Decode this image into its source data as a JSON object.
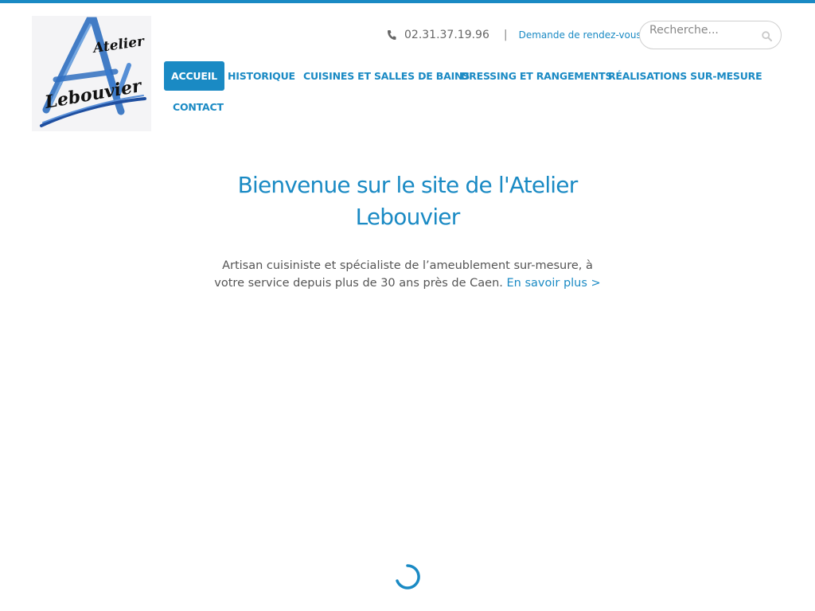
{
  "brand": {
    "logo_word_1": "Atelier",
    "logo_word_2": "Lebouvier",
    "accent": "#1a8ac4"
  },
  "header": {
    "phone_icon": "phone-icon",
    "phone": "02.31.37.19.96",
    "separator": "|",
    "appointment_link": "Demande de rendez-vous",
    "search": {
      "placeholder": "Recherche...",
      "icon": "search-icon"
    }
  },
  "nav": {
    "items": [
      {
        "label": "ACCUEIL",
        "active": true
      },
      {
        "label": "HISTORIQUE",
        "active": false
      },
      {
        "label": "CUISINES ET SALLES DE BAINS",
        "active": false
      },
      {
        "label": "DRESSING ET RANGEMENTS",
        "active": false
      },
      {
        "label": "RÉALISATIONS SUR-MESURE",
        "active": false
      },
      {
        "label": "CONTACT",
        "active": false
      }
    ]
  },
  "main": {
    "title": "Bienvenue sur le site de l'Atelier Lebouvier",
    "intro": "Artisan cuisiniste et spécialiste de l’ameublement sur-mesure, à votre service depuis plus de 30 ans près de Caen.",
    "more_link": "En savoir plus >"
  },
  "loading": {
    "icon": "loading-spinner-icon"
  }
}
